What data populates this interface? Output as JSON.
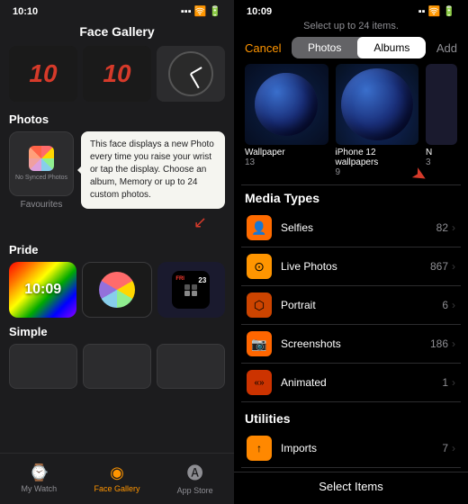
{
  "left": {
    "status_time": "10:10",
    "title": "Face Gallery",
    "sections": {
      "photos_label": "Photos",
      "pride_label": "Pride",
      "simple_label": "Simple"
    },
    "tooltip": "This face displays a new Photo every time you raise your wrist or tap the display. Choose an album, Memory or up to 24 custom photos.",
    "no_sync_label": "No Synced Photos",
    "favourites_label": "Favourites",
    "nav": {
      "my_watch": "My Watch",
      "face_gallery": "Face Gallery",
      "app_store": "App Store"
    }
  },
  "right": {
    "status_time": "10:09",
    "select_hint": "Select up to 24 items.",
    "cancel_label": "Cancel",
    "add_label": "Add",
    "tabs": [
      "Photos",
      "Albums"
    ],
    "active_tab": "Albums",
    "albums": [
      {
        "name": "Wallpaper",
        "count": "13"
      },
      {
        "name": "iPhone 12 wallpapers",
        "count": "9"
      },
      {
        "name": "N",
        "count": "3"
      }
    ],
    "media_types_header": "Media Types",
    "media_items": [
      {
        "name": "Selfies",
        "count": "82",
        "icon": "👤"
      },
      {
        "name": "Live Photos",
        "count": "867",
        "icon": "⊙"
      },
      {
        "name": "Portrait",
        "count": "6",
        "icon": "⬡"
      },
      {
        "name": "Screenshots",
        "count": "186",
        "icon": "📷"
      },
      {
        "name": "Animated",
        "count": "1",
        "icon": "«»"
      }
    ],
    "utilities_header": "Utilities",
    "utility_items": [
      {
        "name": "Imports",
        "count": "7",
        "icon": "↑"
      }
    ],
    "select_items_label": "Select Items"
  }
}
